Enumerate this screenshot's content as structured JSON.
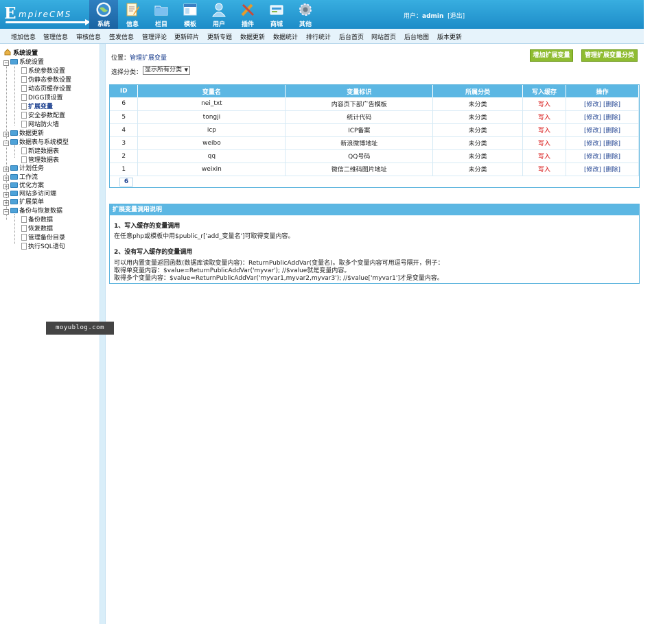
{
  "logo": {
    "first": "E",
    "rest": "mpireCMS"
  },
  "nav": [
    {
      "label": "系统",
      "icon": "globe-icon",
      "active": true
    },
    {
      "label": "信息",
      "icon": "edit-icon"
    },
    {
      "label": "栏目",
      "icon": "folder-icon"
    },
    {
      "label": "模板",
      "icon": "window-icon"
    },
    {
      "label": "用户",
      "icon": "user-icon"
    },
    {
      "label": "插件",
      "icon": "tools-icon"
    },
    {
      "label": "商城",
      "icon": "card-icon"
    },
    {
      "label": "其他",
      "icon": "gear-icon"
    }
  ],
  "user": {
    "prefix": "用户：",
    "name": "admin",
    "logout": "[退出]"
  },
  "submenu": [
    "增加信息",
    "管理信息",
    "审核信息",
    "签发信息",
    "管理评论",
    "更新碎片",
    "更新专题",
    "数据更新",
    "数据统计",
    "排行统计",
    "后台首页",
    "网站首页",
    "后台地图",
    "版本更新"
  ],
  "tree": {
    "root": "系统设置",
    "items": [
      {
        "label": "系统设置",
        "type": "open"
      },
      {
        "label": "系统参数设置",
        "type": "leaf"
      },
      {
        "label": "伪静态参数设置",
        "type": "leaf"
      },
      {
        "label": "动态页缓存设置",
        "type": "leaf"
      },
      {
        "label": "DIGG顶设置",
        "type": "leaf"
      },
      {
        "label": "扩展变量",
        "type": "leaf",
        "highlight": true
      },
      {
        "label": "安全参数配置",
        "type": "leaf"
      },
      {
        "label": "网站防火墙",
        "type": "leaf"
      },
      {
        "label": "数据更新",
        "type": "closed"
      },
      {
        "label": "数据表与系统模型",
        "type": "open"
      },
      {
        "label": "新建数据表",
        "type": "leaf"
      },
      {
        "label": "管理数据表",
        "type": "leaf"
      },
      {
        "label": "计划任务",
        "type": "closed"
      },
      {
        "label": "工作流",
        "type": "closed"
      },
      {
        "label": "优化方案",
        "type": "closed"
      },
      {
        "label": "网站多访问端",
        "type": "closed"
      },
      {
        "label": "扩展菜单",
        "type": "closed"
      },
      {
        "label": "备份与恢复数据",
        "type": "open"
      },
      {
        "label": "备份数据",
        "type": "leaf"
      },
      {
        "label": "恢复数据",
        "type": "leaf"
      },
      {
        "label": "管理备份目录",
        "type": "leaf"
      },
      {
        "label": "执行SQL语句",
        "type": "leaf"
      }
    ]
  },
  "watermark": "moyublog.com",
  "breadcrumb": {
    "prefix": "位置：",
    "link": "管理扩展变量"
  },
  "buttons": {
    "add": "增加扩展变量",
    "manage_class": "管理扩展变量分类"
  },
  "filter": {
    "label": "选择分类：",
    "value": "显示所有分类"
  },
  "table": {
    "headers": [
      "ID",
      "变量名",
      "变量标识",
      "所属分类",
      "写入缓存",
      "操作"
    ],
    "rows": [
      {
        "id": "6",
        "name": "nei_txt",
        "title": "内容页下部广告模板",
        "class": "未分类",
        "cache": "写入",
        "edit": "[修改]",
        "del": "[删除]"
      },
      {
        "id": "5",
        "name": "tongji",
        "title": "统计代码",
        "class": "未分类",
        "cache": "写入",
        "edit": "[修改]",
        "del": "[删除]"
      },
      {
        "id": "4",
        "name": "icp",
        "title": "ICP备案",
        "class": "未分类",
        "cache": "写入",
        "edit": "[修改]",
        "del": "[删除]"
      },
      {
        "id": "3",
        "name": "weibo",
        "title": "新浪微博地址",
        "class": "未分类",
        "cache": "写入",
        "edit": "[修改]",
        "del": "[删除]"
      },
      {
        "id": "2",
        "name": "qq",
        "title": "QQ号码",
        "class": "未分类",
        "cache": "写入",
        "edit": "[修改]",
        "del": "[删除]"
      },
      {
        "id": "1",
        "name": "weixin",
        "title": "微信二维码图片地址",
        "class": "未分类",
        "cache": "写入",
        "edit": "[修改]",
        "del": "[删除]"
      }
    ],
    "page": "6"
  },
  "help": {
    "title": "扩展变量调用说明",
    "h1": "1、写入缓存的变量调用",
    "p1": "在任意php或模板中用$public_r['add_变量名']可取得变量内容。",
    "h2": "2、没有写入缓存的变量调用",
    "p2": "可以用内置变量返回函数(数据库读取变量内容)：ReturnPublicAddVar(变量名)。取多个变量内容可用逗号隔开，例子：",
    "p3": "取得单变量内容：$value=ReturnPublicAddVar('myvar'); //$value就是变量内容。",
    "p4": "取得多个变量内容：$value=ReturnPublicAddVar('myvar1,myvar2,myvar3'); //$value['myvar1']才是变量内容。"
  },
  "colors": {
    "header": "#1d8cc8",
    "table_head": "#5cb7e3",
    "button": "#8fbc31",
    "write": "#d40000",
    "link": "#1b3f8f"
  }
}
